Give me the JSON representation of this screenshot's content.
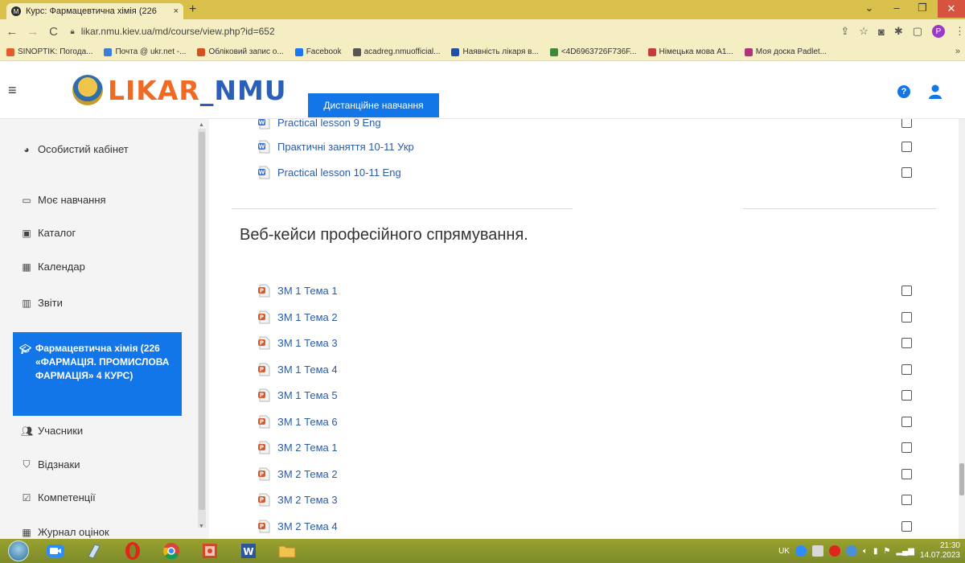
{
  "browser": {
    "tab_title": "Курс: Фармацевтична хімія (226",
    "tab_close": "×",
    "new_tab": "+",
    "url": "likar.nmu.kiev.ua/md/course/view.php?id=652",
    "profile_letter": "P",
    "bookmarks": [
      {
        "label": "SINOPTIK: Погода...",
        "color": "#e45b2b"
      },
      {
        "label": "Почта @ ukr.net -...",
        "color": "#3b7dd8"
      },
      {
        "label": "Обліковий запис о...",
        "color": "#d95020"
      },
      {
        "label": "Facebook",
        "color": "#1877f2"
      },
      {
        "label": "acadreg.nmuofficial...",
        "color": "#555555"
      },
      {
        "label": "Наявність лікаря в...",
        "color": "#1f4fa8"
      },
      {
        "label": "<4D6963726F736F...",
        "color": "#3b8b3b"
      },
      {
        "label": "Німецька мова А1...",
        "color": "#c43b3b"
      },
      {
        "label": "Моя доска Padlet...",
        "color": "#b0327a"
      }
    ],
    "bookmarks_more": "»"
  },
  "header": {
    "logo_main": "LIKAR",
    "logo_tail": "_NMU",
    "distance_button": "Дистанційне навчання",
    "help": "?"
  },
  "drawer": {
    "items": [
      {
        "label": "Особистий кабінет",
        "icon": "dashboard-icon"
      },
      {
        "label": "Моє навчання",
        "icon": "courses-icon"
      },
      {
        "label": "Каталог",
        "icon": "catalog-icon"
      },
      {
        "label": "Календар",
        "icon": "calendar-icon"
      },
      {
        "label": "Звіти",
        "icon": "reports-icon"
      }
    ],
    "active_course": "Фармацевтична хімія (226 «ФАРМАЦІЯ. ПРОМИСЛОВА ФАРМАЦІЯ» 4 КУРС)",
    "course_items": [
      {
        "label": "Учасники",
        "icon": "participants-icon"
      },
      {
        "label": "Відзнаки",
        "icon": "badges-icon"
      },
      {
        "label": "Компетенції",
        "icon": "competencies-icon"
      },
      {
        "label": "Журнал оцінок",
        "icon": "grades-icon"
      }
    ]
  },
  "main": {
    "top_activities": [
      {
        "label": "Practical lesson 9 Eng",
        "type": "word"
      },
      {
        "label": "Практичні заняття 10-11 Укр",
        "type": "word"
      },
      {
        "label": "Practical lesson 10-11 Eng",
        "type": "word"
      }
    ],
    "section_title": "Веб-кейси професійного спрямування.",
    "section_activities": [
      {
        "label": "ЗМ 1 Тема 1",
        "type": "powerpoint"
      },
      {
        "label": "ЗМ 1 Тема 2",
        "type": "powerpoint"
      },
      {
        "label": "ЗМ 1 Тема 3",
        "type": "powerpoint"
      },
      {
        "label": "ЗМ 1 Тема 4",
        "type": "powerpoint"
      },
      {
        "label": "ЗМ 1 Тема 5",
        "type": "powerpoint"
      },
      {
        "label": "ЗМ 1 Тема 6",
        "type": "powerpoint"
      },
      {
        "label": "ЗМ 2 Тема 1",
        "type": "powerpoint"
      },
      {
        "label": "ЗМ 2 Тема 2",
        "type": "powerpoint"
      },
      {
        "label": "ЗМ 2 Тема 3",
        "type": "powerpoint"
      },
      {
        "label": "ЗМ 2 Тема 4",
        "type": "powerpoint"
      }
    ]
  },
  "taskbar": {
    "language": "UK",
    "time": "21:30",
    "date": "14.07.2023"
  }
}
